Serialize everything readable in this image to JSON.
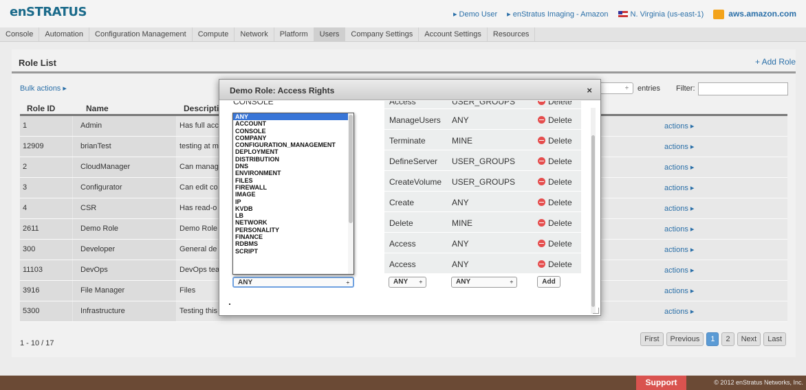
{
  "header": {
    "logo": "enSTRATUS",
    "user_link": "▸ Demo User",
    "account_link": "▸ enStratus Imaging - Amazon",
    "region": "N. Virginia (us-east-1)",
    "cloud": "aws.amazon.com"
  },
  "nav": {
    "items": [
      {
        "label": "Console"
      },
      {
        "label": "Automation"
      },
      {
        "label": "Configuration Management"
      },
      {
        "label": "Compute"
      },
      {
        "label": "Network"
      },
      {
        "label": "Platform"
      },
      {
        "label": "Users"
      },
      {
        "label": "Company Settings"
      },
      {
        "label": "Account Settings"
      },
      {
        "label": "Resources"
      }
    ],
    "active": "Users"
  },
  "page": {
    "title": "Role List",
    "add_role": "+ Add Role",
    "bulk_actions": "Bulk actions ▸",
    "entries_label": "entries",
    "entries_arrow": "÷",
    "filter_label": "Filter:",
    "filter_value": "",
    "columns": [
      "Role ID",
      "Name",
      "Descriptio"
    ],
    "rows": [
      {
        "id": "1",
        "name": "Admin",
        "desc": "Has full acc",
        "action": "actions ▸"
      },
      {
        "id": "12909",
        "name": "brianTest",
        "desc": "testing at m",
        "action": "actions ▸"
      },
      {
        "id": "2",
        "name": "CloudManager",
        "desc": "Can manag",
        "action": "actions ▸"
      },
      {
        "id": "3",
        "name": "Configurator",
        "desc": "Can edit co",
        "action": "actions ▸"
      },
      {
        "id": "4",
        "name": "CSR",
        "desc": "Has read-o",
        "action": "actions ▸"
      },
      {
        "id": "2611",
        "name": "Demo Role",
        "desc": "Demo Role",
        "action": "actions ▸"
      },
      {
        "id": "300",
        "name": "Developer",
        "desc": "General de",
        "action": "actions ▸"
      },
      {
        "id": "11103",
        "name": "DevOps",
        "desc": "DevOps tea",
        "action": "actions ▸"
      },
      {
        "id": "3916",
        "name": "File Manager",
        "desc": "Files",
        "action": "actions ▸"
      },
      {
        "id": "5300",
        "name": "Infrastructure",
        "desc": "Testing this",
        "action": "actions ▸"
      }
    ],
    "pager_info": "1 - 10 / 17",
    "pager": {
      "first": "First",
      "previous": "Previous",
      "page1": "1",
      "page2": "2",
      "next": "Next",
      "last": "Last"
    }
  },
  "modal": {
    "title": "Demo Role: Access Rights",
    "close": "×",
    "partial_left": "CONSOLE",
    "partial_row": {
      "action": "Access",
      "type": "USER_GROUPS",
      "delete": "Delete"
    },
    "rights": [
      {
        "action": "ManageUsers",
        "type": "ANY",
        "delete": "Delete"
      },
      {
        "action": "Terminate",
        "type": "MINE",
        "delete": "Delete"
      },
      {
        "action": "DefineServer",
        "type": "USER_GROUPS",
        "delete": "Delete"
      },
      {
        "action": "CreateVolume",
        "type": "USER_GROUPS",
        "delete": "Delete"
      },
      {
        "action": "Create",
        "type": "ANY",
        "delete": "Delete"
      },
      {
        "action": "Delete",
        "type": "MINE",
        "delete": "Delete"
      },
      {
        "action": "Access",
        "type": "ANY",
        "delete": "Delete"
      },
      {
        "action": "Access",
        "type": "ANY",
        "delete": "Delete"
      }
    ],
    "resource_options": [
      "ANY",
      "ACCOUNT",
      "CONSOLE",
      "COMPANY",
      "CONFIGURATION_MANAGEMENT",
      "DEPLOYMENT",
      "DISTRIBUTION",
      "DNS",
      "ENVIRONMENT",
      "FILES",
      "FIREWALL",
      "IMAGE",
      "IP",
      "KVDB",
      "LB",
      "NETWORK",
      "PERSONALITY",
      "FINANCE",
      "RDBMS",
      "SCRIPT"
    ],
    "resource_selected": "ANY",
    "select_arrow": "÷",
    "action_selected": "ANY",
    "type_selected": "ANY",
    "add_button": "Add"
  },
  "footer": {
    "support": "Support",
    "copyright": "© 2012 enStratus Networks, Inc."
  },
  "colors": {
    "link": "#2a6fa8",
    "selected": "#3875d7",
    "footer": "#6b4a35",
    "support": "#d9534f",
    "page_current": "#5b9bd5"
  }
}
